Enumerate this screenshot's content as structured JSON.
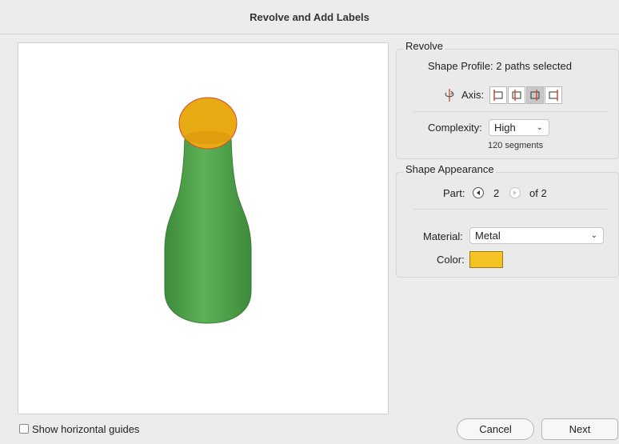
{
  "window": {
    "title": "Revolve and Add Labels"
  },
  "revolve": {
    "section_title": "Revolve",
    "shape_profile": "Shape Profile: 2 paths selected",
    "axis_label": "Axis:",
    "axis_buttons": [
      "axis-left-edge",
      "axis-left-center",
      "axis-right-center",
      "axis-right-edge"
    ],
    "axis_selected_index": 2,
    "complexity_label": "Complexity:",
    "complexity_value": "High",
    "segments_text": "120 segments"
  },
  "appearance": {
    "section_title": "Shape Appearance",
    "part_label": "Part:",
    "part_value": "2",
    "part_total": "of 2",
    "material_label": "Material:",
    "material_value": "Metal",
    "color_label": "Color:",
    "color_value": "#f6c325"
  },
  "preview": {
    "bottle_color": "#52a34f",
    "cap_color": "#e8aa12"
  },
  "footer": {
    "show_guides_label": "Show horizontal guides",
    "show_guides_checked": false,
    "cancel_label": "Cancel",
    "next_label": "Next"
  }
}
